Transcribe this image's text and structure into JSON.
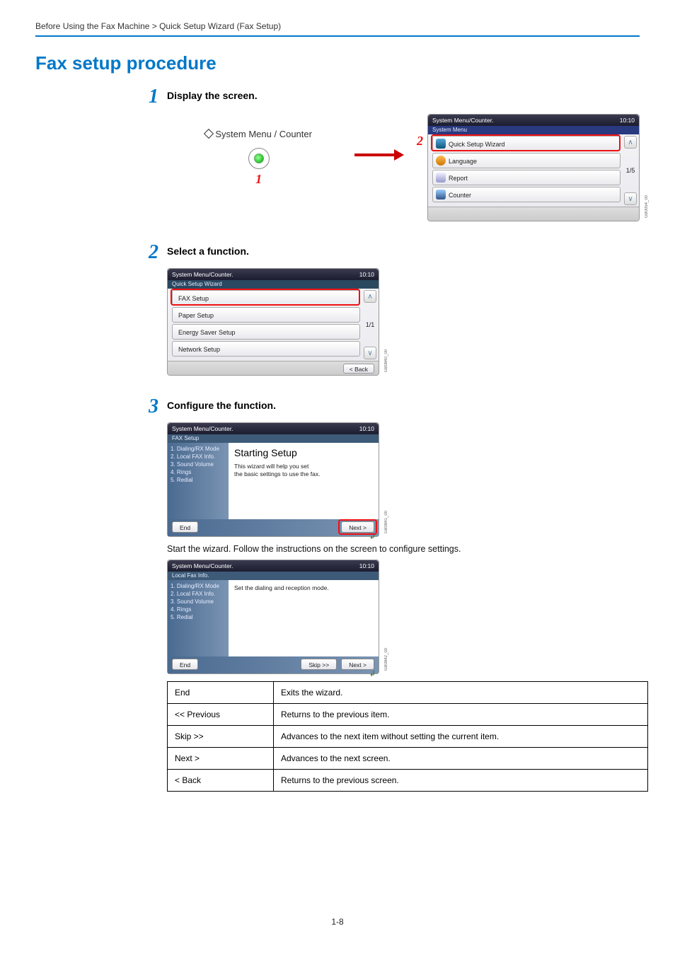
{
  "breadcrumb": "Before Using the Fax Machine > Quick Setup Wizard (Fax Setup)",
  "heading": "Fax setup procedure",
  "steps": {
    "s1": {
      "num": "1",
      "title": "Display the screen."
    },
    "s2": {
      "num": "2",
      "title": "Select a function."
    },
    "s3": {
      "num": "3",
      "title": "Configure the function."
    }
  },
  "hw": {
    "label": "System Menu / Counter",
    "callout1": "1",
    "callout2": "2"
  },
  "panel1": {
    "header": "System Menu/Counter.",
    "time": "10:10",
    "sub": "System Menu",
    "items": [
      "Quick Setup Wizard",
      "Language",
      "Report",
      "Counter"
    ],
    "page": "1/5",
    "sidecode": "GB0054_00"
  },
  "panel2": {
    "header": "System Menu/Counter.",
    "time": "10:10",
    "sub": "Quick Setup Wizard",
    "items": [
      "FAX Setup",
      "Paper Setup",
      "Energy Saver Setup",
      "Network Setup"
    ],
    "page": "1/1",
    "back": "< Back",
    "sidecode": "GB0840_00"
  },
  "panel3a": {
    "header": "System Menu/Counter.",
    "time": "10:10",
    "sub": "FAX Setup",
    "side": [
      "1. Dialing/RX Mode",
      "2. Local FAX Info.",
      "3. Sound Volume",
      "4. Rings",
      "5. Redial"
    ],
    "big": "Starting Setup",
    "msg1": "This wizard will help you set",
    "msg2": "the basic settings to use the fax.",
    "end": "End",
    "next": "Next >",
    "sidecode": "GB0841_00"
  },
  "body_text": "Start the wizard. Follow the instructions on the screen to configure settings.",
  "panel3b": {
    "header": "System Menu/Counter.",
    "time": "10:10",
    "sub": "Local Fax Info.",
    "side": [
      "1. Dialing/RX Mode",
      "2. Local FAX Info.",
      "3. Sound Volume",
      "4. Rings",
      "5. Redial"
    ],
    "msg": "Set the dialing and reception mode.",
    "end": "End",
    "skip": "Skip >>",
    "next": "Next >",
    "sidecode": "GB0842_00"
  },
  "defs": [
    {
      "k": "End",
      "v": "Exits the wizard."
    },
    {
      "k": "<< Previous",
      "v": "Returns to the previous item."
    },
    {
      "k": "Skip >>",
      "v": "Advances to the next item without setting the current item."
    },
    {
      "k": "Next >",
      "v": "Advances to the next screen."
    },
    {
      "k": "< Back",
      "v": "Returns to the previous screen."
    }
  ],
  "page_number": "1-8"
}
